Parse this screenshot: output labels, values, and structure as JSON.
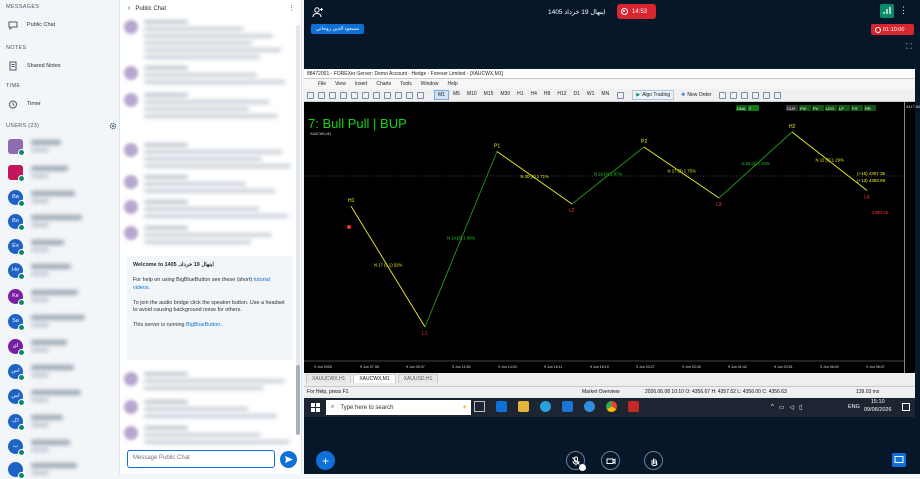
{
  "sidebar": {
    "messages_heading": "MESSAGES",
    "public_chat": "Public Chat",
    "notes_heading": "NOTES",
    "shared_notes": "Shared Notes",
    "time_heading": "TIME",
    "timer": "Timer",
    "users_heading": "USERS (23)",
    "users": [
      {
        "initials": "",
        "color": "#8c6bb1"
      },
      {
        "initials": "",
        "color": "#c2185b"
      },
      {
        "initials": "Ba",
        "color": "#1e63c4"
      },
      {
        "initials": "Bo",
        "color": "#1e63c4"
      },
      {
        "initials": "Es",
        "color": "#1e63c4"
      },
      {
        "initials": "Ho",
        "color": "#1e63c4"
      },
      {
        "initials": "Ke",
        "color": "#7b1fa2"
      },
      {
        "initials": "Sa",
        "color": "#1e63c4"
      },
      {
        "initials": "ای",
        "color": "#7b1fa2"
      },
      {
        "initials": "اس",
        "color": "#1e63c4"
      },
      {
        "initials": "اس",
        "color": "#1e63c4"
      },
      {
        "initials": "اک",
        "color": "#1e63c4"
      },
      {
        "initials": "ب",
        "color": "#1e63c4"
      },
      {
        "initials": "",
        "color": "#1e63c4"
      }
    ]
  },
  "chat": {
    "header_title": "Public Chat",
    "welcome_title": "Welcome to 1405 ,ﺍﻳﻨﻬﺎﻝ 19 ﺧﺮﺩﺍﺩ",
    "welcome_help": "For help on using BigBlueButton see these (short)",
    "welcome_link": "tutorial videos",
    "welcome_audio": "To join the audio bridge click the speaker button. Use a headset to avoid causing background noise for others.",
    "welcome_running": "This server is running",
    "welcome_bbb": "BigBlueButton",
    "input_placeholder": "Message Public Chat"
  },
  "meeting": {
    "title": "ﺍﻳﻨﻬﺎﻝ 19 ﺧﺮﺩﺍﺩ 1405",
    "recording_time": "14:53",
    "presenter": "ﻣﺴﻌﻮﺩ ﺍﻟﺪﻳﻦ ﺭﻭﺣﺎﻧﻲ",
    "session_timer": "01:10:00"
  },
  "mt5": {
    "window_title": "88472001 - FOREXer-Server: Demo Account - Hedge - Forexer Limited - [XAUCWX,M1]",
    "menu": [
      "File",
      "View",
      "Insert",
      "Charts",
      "Tools",
      "Window",
      "Help"
    ],
    "timeframes": [
      "M1",
      "M5",
      "M10",
      "M15",
      "M30",
      "H1",
      "H4",
      "H8",
      "H12",
      "D1",
      "W1",
      "MN"
    ],
    "algo_trading": "Algo Trading",
    "new_order": "New Order",
    "chart_symbol": "XAUCWX,M1",
    "overlay_title": "7: Bull Pull | BUP",
    "right_badges": [
      "CLR",
      "PIV",
      "PV",
      "LEG",
      "LP",
      "FIT",
      "RR"
    ],
    "left_badges": [
      "DNA",
      "7"
    ],
    "price_labels": [
      "(+16)  4397.36",
      "(+13)  4393.69"
    ],
    "red_label": "4380.56",
    "time_axis": [
      "9 Jun 2026",
      "9 Jun 07:38",
      "9 Jun 09:47",
      "9 Jun 11:55",
      "9 Jun 14:03",
      "9 Jun 16:11",
      "9 Jun 18:19",
      "9 Jun 20:27",
      "9 Jun 23:35",
      "9 Jun 01:42",
      "9 Jun 03:51",
      "9 Jun 06:00",
      "9 Jun 08:07",
      "9 Jun 10:15"
    ],
    "tabs": [
      "XAUUCWX,H1",
      "XAUCWX,M1",
      "XAUUSD,H1"
    ],
    "status_help": "For Help, press F1",
    "status_market": "Market Overview",
    "status_ohlc": "2026.06.08 10:10    O: 4356.67    H: 4357.52    L: 4356.00    C: 4356.63",
    "status_ping": "139.03 ms",
    "price_top": "4417.66"
  },
  "chart_data": {
    "type": "line",
    "title": "7: Bull Pull | BUP",
    "xlabel": "",
    "ylabel": "",
    "series": [
      {
        "name": "",
        "x": [
          "H1",
          "L1",
          "P1",
          "L2",
          "P2",
          "L3",
          "H2",
          "L4"
        ],
        "values": [
          4380.3,
          4340.0,
          4398.5,
          4381.0,
          4400.0,
          4383.0,
          4405.0,
          4385.5
        ]
      }
    ],
    "labels": [
      "H1",
      "L1",
      "P1",
      "L2",
      "P2",
      "L3",
      "H2",
      "L4"
    ],
    "annotations": [
      "N 17 (1.1) 52%",
      "N 14 (6) 1 80%",
      "N 20 (4) 1 71%",
      "N 16 (4) 1 87%",
      "N 17 (3) 1 75%",
      "N 23 (4) 1 34%",
      "N 12 (3) 1 29%"
    ]
  },
  "taskbar": {
    "search_placeholder": "Type here to search",
    "time": "15:10",
    "date": "09/06/2026",
    "lang": "ENG"
  }
}
